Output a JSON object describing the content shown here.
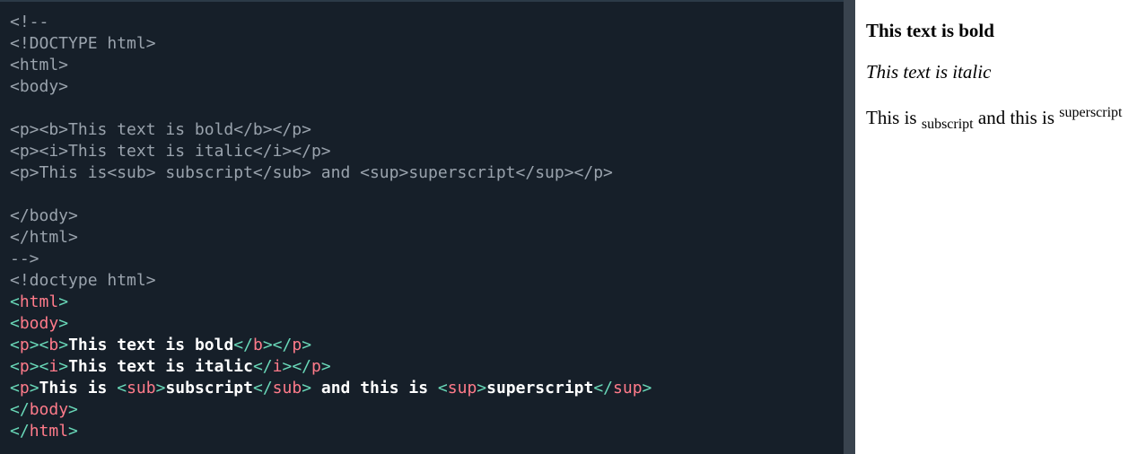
{
  "editor": {
    "comment_lines": [
      "<!--",
      "<!DOCTYPE html>",
      "<html>",
      "<body>",
      "",
      "<p><b>This text is bold</b></p>",
      "<p><i>This text is italic</i></p>",
      "<p>This is<sub> subscript</sub> and <sup>superscript</sup></p>",
      "",
      "</body>",
      "</html>",
      "-->",
      "<!doctype html>"
    ],
    "tokens": {
      "lt": "<",
      "lts": "</",
      "gt": ">",
      "html": "html",
      "body": "body",
      "p": "p",
      "b": "b",
      "i": "i",
      "sub": "sub",
      "sup": "sup",
      "bold_text": "This text is bold",
      "italic_text": "This text is italic",
      "this_is": "This is ",
      "subscript": "subscript",
      "and_this_is": " and this is ",
      "superscript": "superscript"
    }
  },
  "preview": {
    "bold_text": "This text is bold",
    "italic_text": "This text is italic",
    "line3_prefix": "This is ",
    "subscript": "subscript",
    "line3_middle": " and this is ",
    "superscript": "superscript"
  },
  "colors": {
    "editor_bg": "#161f29",
    "comment": "#9aa3ad",
    "bracket": "#69d8b8",
    "tag_name": "#ff7b8a",
    "text": "#ffffff"
  }
}
